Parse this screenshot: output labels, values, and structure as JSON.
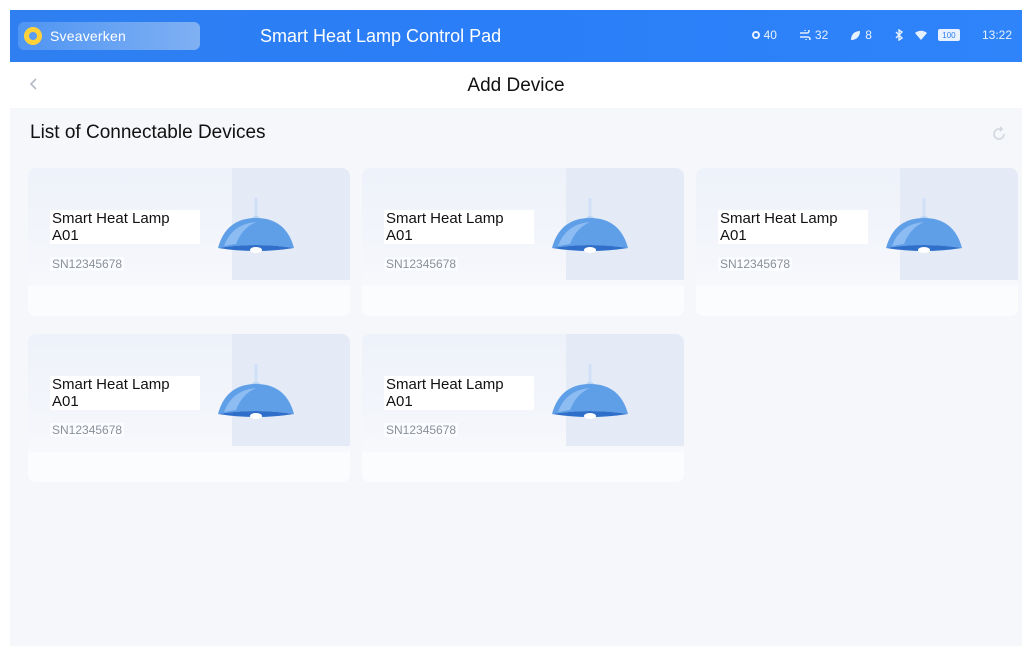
{
  "status_bar": {
    "brand_name": "Sveaverken",
    "app_title": "Smart Heat Lamp Control Pad",
    "stats": [
      {
        "icon": "dot-icon",
        "value": "40"
      },
      {
        "icon": "wind-icon",
        "value": "32"
      },
      {
        "icon": "leaf-icon",
        "value": "8"
      }
    ],
    "battery_label": "100",
    "time": "13:22",
    "accent_color": "#2f7ff0"
  },
  "titlebar": {
    "back_icon": "chevron-left-icon",
    "title": "Add Device"
  },
  "section": {
    "title": "List of Connectable Devices",
    "refresh_icon": "refresh-icon"
  },
  "devices": [
    {
      "name": "Smart Heat Lamp A01",
      "sn": "SN12345678",
      "icon": "heat-lamp-icon"
    },
    {
      "name": "Smart Heat Lamp A01",
      "sn": "SN12345678",
      "icon": "heat-lamp-icon"
    },
    {
      "name": "Smart Heat Lamp A01",
      "sn": "SN12345678",
      "icon": "heat-lamp-icon"
    },
    {
      "name": "Smart Heat Lamp A01",
      "sn": "SN12345678",
      "icon": "heat-lamp-icon"
    },
    {
      "name": "Smart Heat Lamp A01",
      "sn": "SN12345678",
      "icon": "heat-lamp-icon"
    }
  ]
}
